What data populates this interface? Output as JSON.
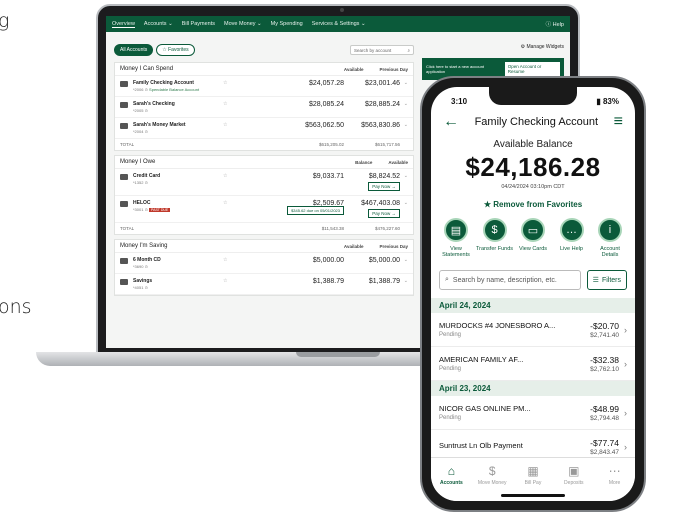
{
  "edge_text": {
    "line1": "g",
    "line2": "ons"
  },
  "laptop": {
    "nav": {
      "items": [
        "Overview",
        "Accounts ⌄",
        "Bill Payments",
        "Move Money ⌄",
        "My Spending",
        "Services & Settings ⌄"
      ],
      "help": "ⓘ Help"
    },
    "filters": {
      "all": "All Accounts",
      "favorites": "☆ Favorites",
      "search_placeholder": "Search by account"
    },
    "spend": {
      "title": "Money I Can Spend",
      "col1": "Available",
      "col2": "Previous Day",
      "accounts": [
        {
          "name": "Family Checking Account",
          "sub": "*2006 ⊙",
          "sub2": "Spendable Balance Account",
          "v1": "$24,057.28",
          "v2": "$23,001.46"
        },
        {
          "name": "Sarah's Checking",
          "sub": "*2005 ⊙",
          "sub2": "",
          "v1": "$28,085.24",
          "v2": "$28,885.24"
        },
        {
          "name": "Sarah's Money Market",
          "sub": "*2004 ⊙",
          "sub2": "",
          "v1": "$563,062.50",
          "v2": "$563,830.86"
        }
      ],
      "total_label": "TOTAL",
      "total1": "$615,205.02",
      "total2": "$615,717.56"
    },
    "owe": {
      "title": "Money I Owe",
      "col1": "Balance",
      "col2": "Available",
      "accounts": [
        {
          "name": "Credit Card",
          "sub": "*1352 ⊙",
          "v1": "$9,033.71",
          "v2": "$8,824.52",
          "pay": "Pay Now →"
        },
        {
          "name": "HELOC",
          "sub": "*3001 ⊙",
          "badge": "PAST DUE",
          "v1": "$2,509.67",
          "v2": "$467,403.08",
          "due": "$345.62 due on 05/01/2023",
          "pay": "Pay Now →"
        }
      ],
      "total_label": "TOTAL",
      "total1": "$11,543.38",
      "total2": "$476,227.60"
    },
    "saving": {
      "title": "Money I'm Saving",
      "col1": "Available",
      "col2": "Previous Day",
      "accounts": [
        {
          "name": "6 Month CD",
          "sub": "*3690 ⊙",
          "v1": "$5,000.00",
          "v2": "$5,000.00"
        },
        {
          "name": "Savings",
          "sub": "*4051 ⊙",
          "v1": "$1,388.79",
          "v2": "$1,388.79"
        }
      ]
    },
    "widgets": {
      "manage": "⚙ Manage Widgets",
      "promo_text": "Click here to start a new account application",
      "promo_btn": "Open Account or Resume"
    }
  },
  "phone": {
    "time": "3:10",
    "battery": "▮ 83%",
    "title": "Family Checking Account",
    "balance_label": "Available Balance",
    "balance": "$24,186.28",
    "as_of": "04/24/2024 03:10pm CDT",
    "favorite": "★ Remove from Favorites",
    "actions": [
      {
        "label": "View Statements",
        "icon": "▤"
      },
      {
        "label": "Transfer Funds",
        "icon": "$"
      },
      {
        "label": "View Cards",
        "icon": "▭"
      },
      {
        "label": "Live Help",
        "icon": "…"
      },
      {
        "label": "Account Details",
        "icon": "i"
      }
    ],
    "search_placeholder": "Search by name, description, etc.",
    "filters": "Filters",
    "groups": [
      {
        "date": "April 24, 2024",
        "txns": [
          {
            "desc": "MURDOCKS #4 JONESBORO A...",
            "status": "Pending",
            "amount": "-$20.70",
            "balance": "$2,741.40"
          },
          {
            "desc": "AMERICAN FAMILY AF...",
            "status": "Pending",
            "amount": "-$32.38",
            "balance": "$2,762.10"
          }
        ]
      },
      {
        "date": "April 23, 2024",
        "txns": [
          {
            "desc": "NICOR GAS ONLINE PM...",
            "status": "Pending",
            "amount": "-$48.99",
            "balance": "$2,794.48"
          },
          {
            "desc": "Suntrust Ln Olb Payment",
            "status": "",
            "amount": "-$77.74",
            "balance": "$2,843.47"
          }
        ]
      }
    ],
    "tabs": [
      {
        "label": "Accounts",
        "icon": "⌂"
      },
      {
        "label": "Move Money",
        "icon": "$"
      },
      {
        "label": "Bill Pay",
        "icon": "▦"
      },
      {
        "label": "Deposits",
        "icon": "▣"
      },
      {
        "label": "More",
        "icon": "⋯"
      }
    ]
  }
}
